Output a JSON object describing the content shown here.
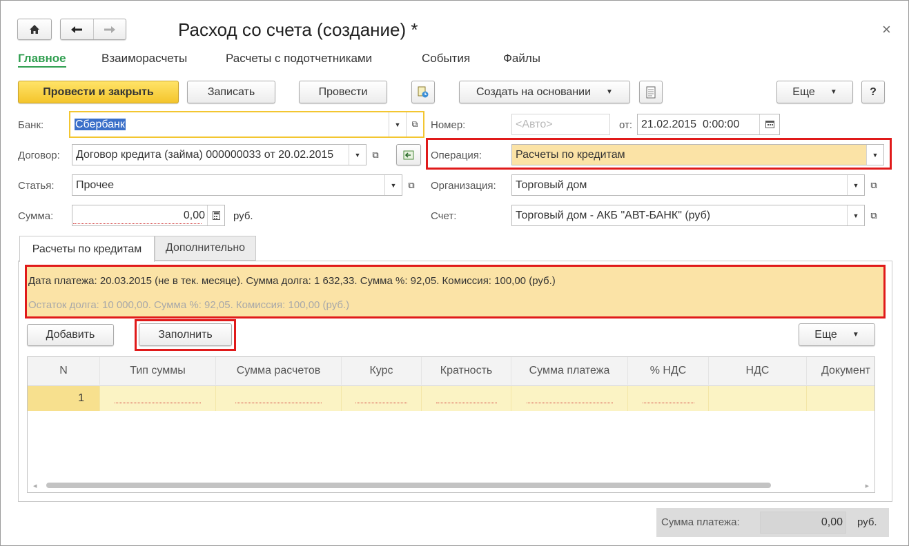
{
  "window": {
    "title": "Расход со счета (создание) *"
  },
  "nav": {
    "home_icon": "home-icon",
    "back_icon": "arrow-left-icon",
    "forward_icon": "arrow-right-icon",
    "close_symbol": "×"
  },
  "sections": [
    "Главное",
    "Взаиморасчеты",
    "Расчеты с подотчетниками",
    "События",
    "Файлы"
  ],
  "toolbar": {
    "post_close": "Провести и закрыть",
    "save": "Записать",
    "post": "Провести",
    "create_based": "Создать на основании",
    "more": "Еще",
    "help": "?"
  },
  "form": {
    "bank_label": "Банк:",
    "bank_value": "Сбербанк",
    "number_label": "Номер:",
    "number_placeholder": "<Авто>",
    "date_from_label": "от:",
    "date_value": "21.02.2015  0:00:00",
    "contract_label": "Договор:",
    "contract_value": "Договор кредита (займа) 000000033 от 20.02.2015",
    "operation_label": "Операция:",
    "operation_value": "Расчеты по кредитам",
    "article_label": "Статья:",
    "article_value": "Прочее",
    "org_label": "Организация:",
    "org_value": "Торговый дом",
    "sum_label": "Сумма:",
    "sum_value": "0,00",
    "sum_currency": "руб.",
    "account_label": "Счет:",
    "account_value": "Торговый дом - АКБ \"АВТ-БАНК\" (руб)"
  },
  "tabs": [
    "Расчеты по кредитам",
    "Дополнительно"
  ],
  "info": {
    "line1": "Дата платежа: 20.03.2015 (не в тек. месяце). Сумма долга: 1 632,33. Сумма %: 92,05. Комиссия: 100,00 (руб.)",
    "line2": "Остаток долга: 10 000,00. Сумма %: 92,05. Комиссия: 100,00 (руб.)"
  },
  "table_toolbar": {
    "add": "Добавить",
    "fill": "Заполнить",
    "more": "Еще"
  },
  "table": {
    "columns": [
      "N",
      "Тип суммы",
      "Сумма расчетов",
      "Курс",
      "Кратность",
      "Сумма платежа",
      "% НДС",
      "НДС",
      "Документ"
    ],
    "rows": [
      {
        "n": "1"
      }
    ]
  },
  "footer": {
    "label": "Сумма платежа:",
    "value": "0,00",
    "currency": "руб."
  }
}
